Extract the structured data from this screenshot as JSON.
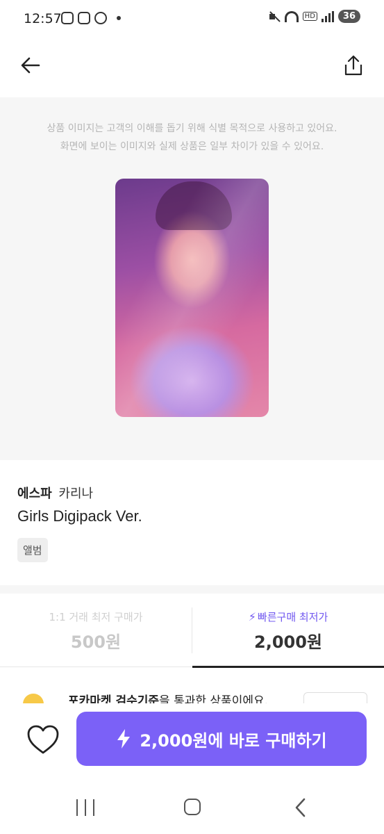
{
  "status_bar": {
    "time": "12:57",
    "hd": "HD",
    "battery": "36"
  },
  "header": {
    "back_icon": "arrow-left-icon",
    "share_icon": "share-icon"
  },
  "image_section": {
    "notice_line1": "상품 이미지는 고객의 이해를 돕기 위해 식별 목적으로 사용하고 있어요.",
    "notice_line2": "화면에 보이는 이미지와 실제 상품은 일부 차이가 있을 수 있어요.",
    "background": "#f6f6f6"
  },
  "product": {
    "artist": "에스파",
    "member": "카리나",
    "title": "Girls Digipack Ver.",
    "category": "앨범"
  },
  "price_tabs": [
    {
      "label": "1:1 거래 최저 구매가",
      "price": "500원",
      "active": false
    },
    {
      "label": "빠른구매 최저가",
      "price": "2,000원",
      "active": true
    }
  ],
  "inspection": {
    "strong": "포카마켓 검수기준",
    "rest": "을 통과한 상품이에요."
  },
  "action_bar": {
    "like_icon": "heart-icon",
    "buy_label": "2,000원에 바로 구매하기",
    "accent": "#7b61f7"
  }
}
